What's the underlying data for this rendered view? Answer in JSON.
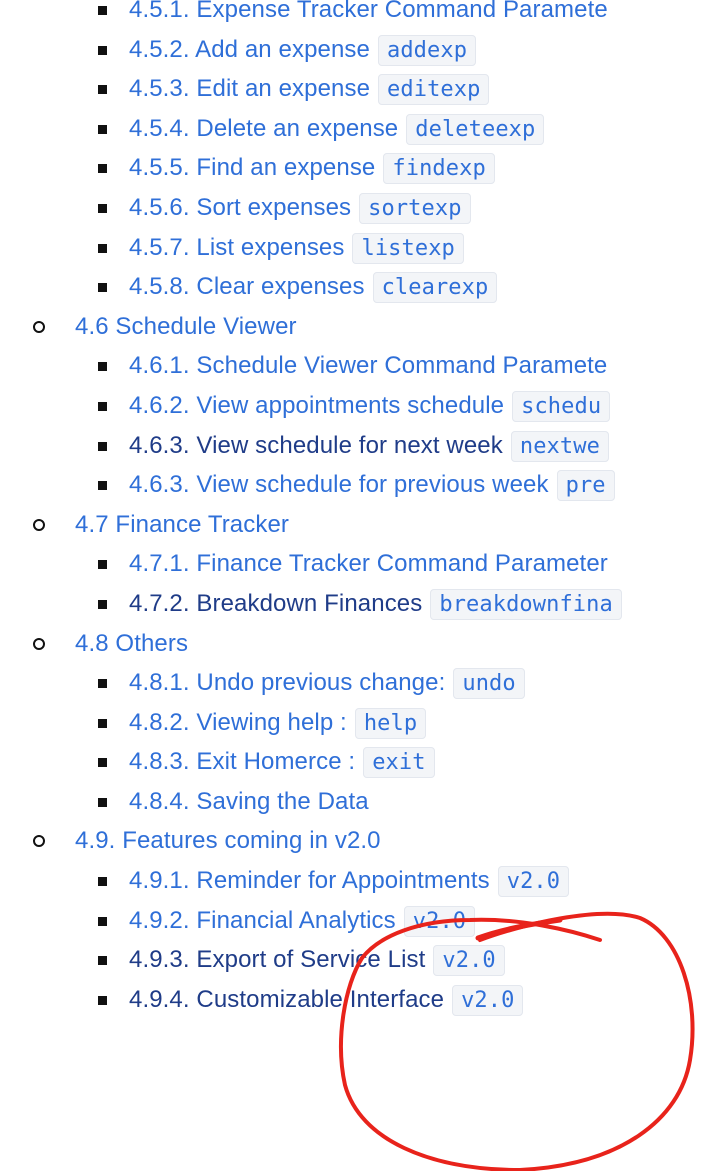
{
  "toc": [
    {
      "level": 2,
      "label": "4.5.1. Expense Tracker Command Paramete",
      "code": ""
    },
    {
      "level": 2,
      "label": "4.5.2. Add an expense",
      "code": "addexp"
    },
    {
      "level": 2,
      "label": "4.5.3. Edit an expense",
      "code": "editexp"
    },
    {
      "level": 2,
      "label": "4.5.4. Delete an expense",
      "code": "deleteexp"
    },
    {
      "level": 2,
      "label": "4.5.5. Find an expense",
      "code": "findexp"
    },
    {
      "level": 2,
      "label": "4.5.6. Sort expenses",
      "code": "sortexp"
    },
    {
      "level": 2,
      "label": "4.5.7. List expenses",
      "code": "listexp"
    },
    {
      "level": 2,
      "label": "4.5.8. Clear expenses",
      "code": "clearexp"
    },
    {
      "level": 1,
      "label": "4.6 Schedule Viewer",
      "code": ""
    },
    {
      "level": 2,
      "label": "4.6.1. Schedule Viewer Command Paramete",
      "code": ""
    },
    {
      "level": 2,
      "label": "4.6.2. View appointments schedule",
      "code": "schedu"
    },
    {
      "level": 2,
      "label": "4.6.3. View schedule for next week",
      "code": "nextwe",
      "visited": true
    },
    {
      "level": 2,
      "label": "4.6.3. View schedule for previous week",
      "code": "pre"
    },
    {
      "level": 1,
      "label": "4.7 Finance Tracker",
      "code": ""
    },
    {
      "level": 2,
      "label": "4.7.1. Finance Tracker Command Parameter",
      "code": ""
    },
    {
      "level": 2,
      "label": "4.7.2. Breakdown Finances",
      "code": "breakdownfina",
      "visited": true
    },
    {
      "level": 1,
      "label": "4.8 Others",
      "code": ""
    },
    {
      "level": 2,
      "label": "4.8.1. Undo previous change:",
      "code": "undo"
    },
    {
      "level": 2,
      "label": "4.8.2. Viewing help :",
      "code": "help"
    },
    {
      "level": 2,
      "label": "4.8.3. Exit Homerce :",
      "code": "exit"
    },
    {
      "level": 2,
      "label": "4.8.4. Saving the Data",
      "code": ""
    },
    {
      "level": 1,
      "label": "4.9. Features coming in v2.0",
      "code": ""
    },
    {
      "level": 2,
      "label": "4.9.1. Reminder for Appointments",
      "code": "v2.0"
    },
    {
      "level": 2,
      "label": "4.9.2. Financial Analytics",
      "code": "v2.0"
    },
    {
      "level": 2,
      "label": "4.9.3. Export of Service List",
      "code": "v2.0",
      "visited": true
    },
    {
      "level": 2,
      "label": "4.9.4. Customizable Interface",
      "code": "v2.0",
      "visited": true
    }
  ],
  "colors": {
    "link": "#2f6fd8",
    "link_visited": "#1f3c88",
    "code_bg": "#f3f5f8",
    "annotation": "#e8231b"
  }
}
